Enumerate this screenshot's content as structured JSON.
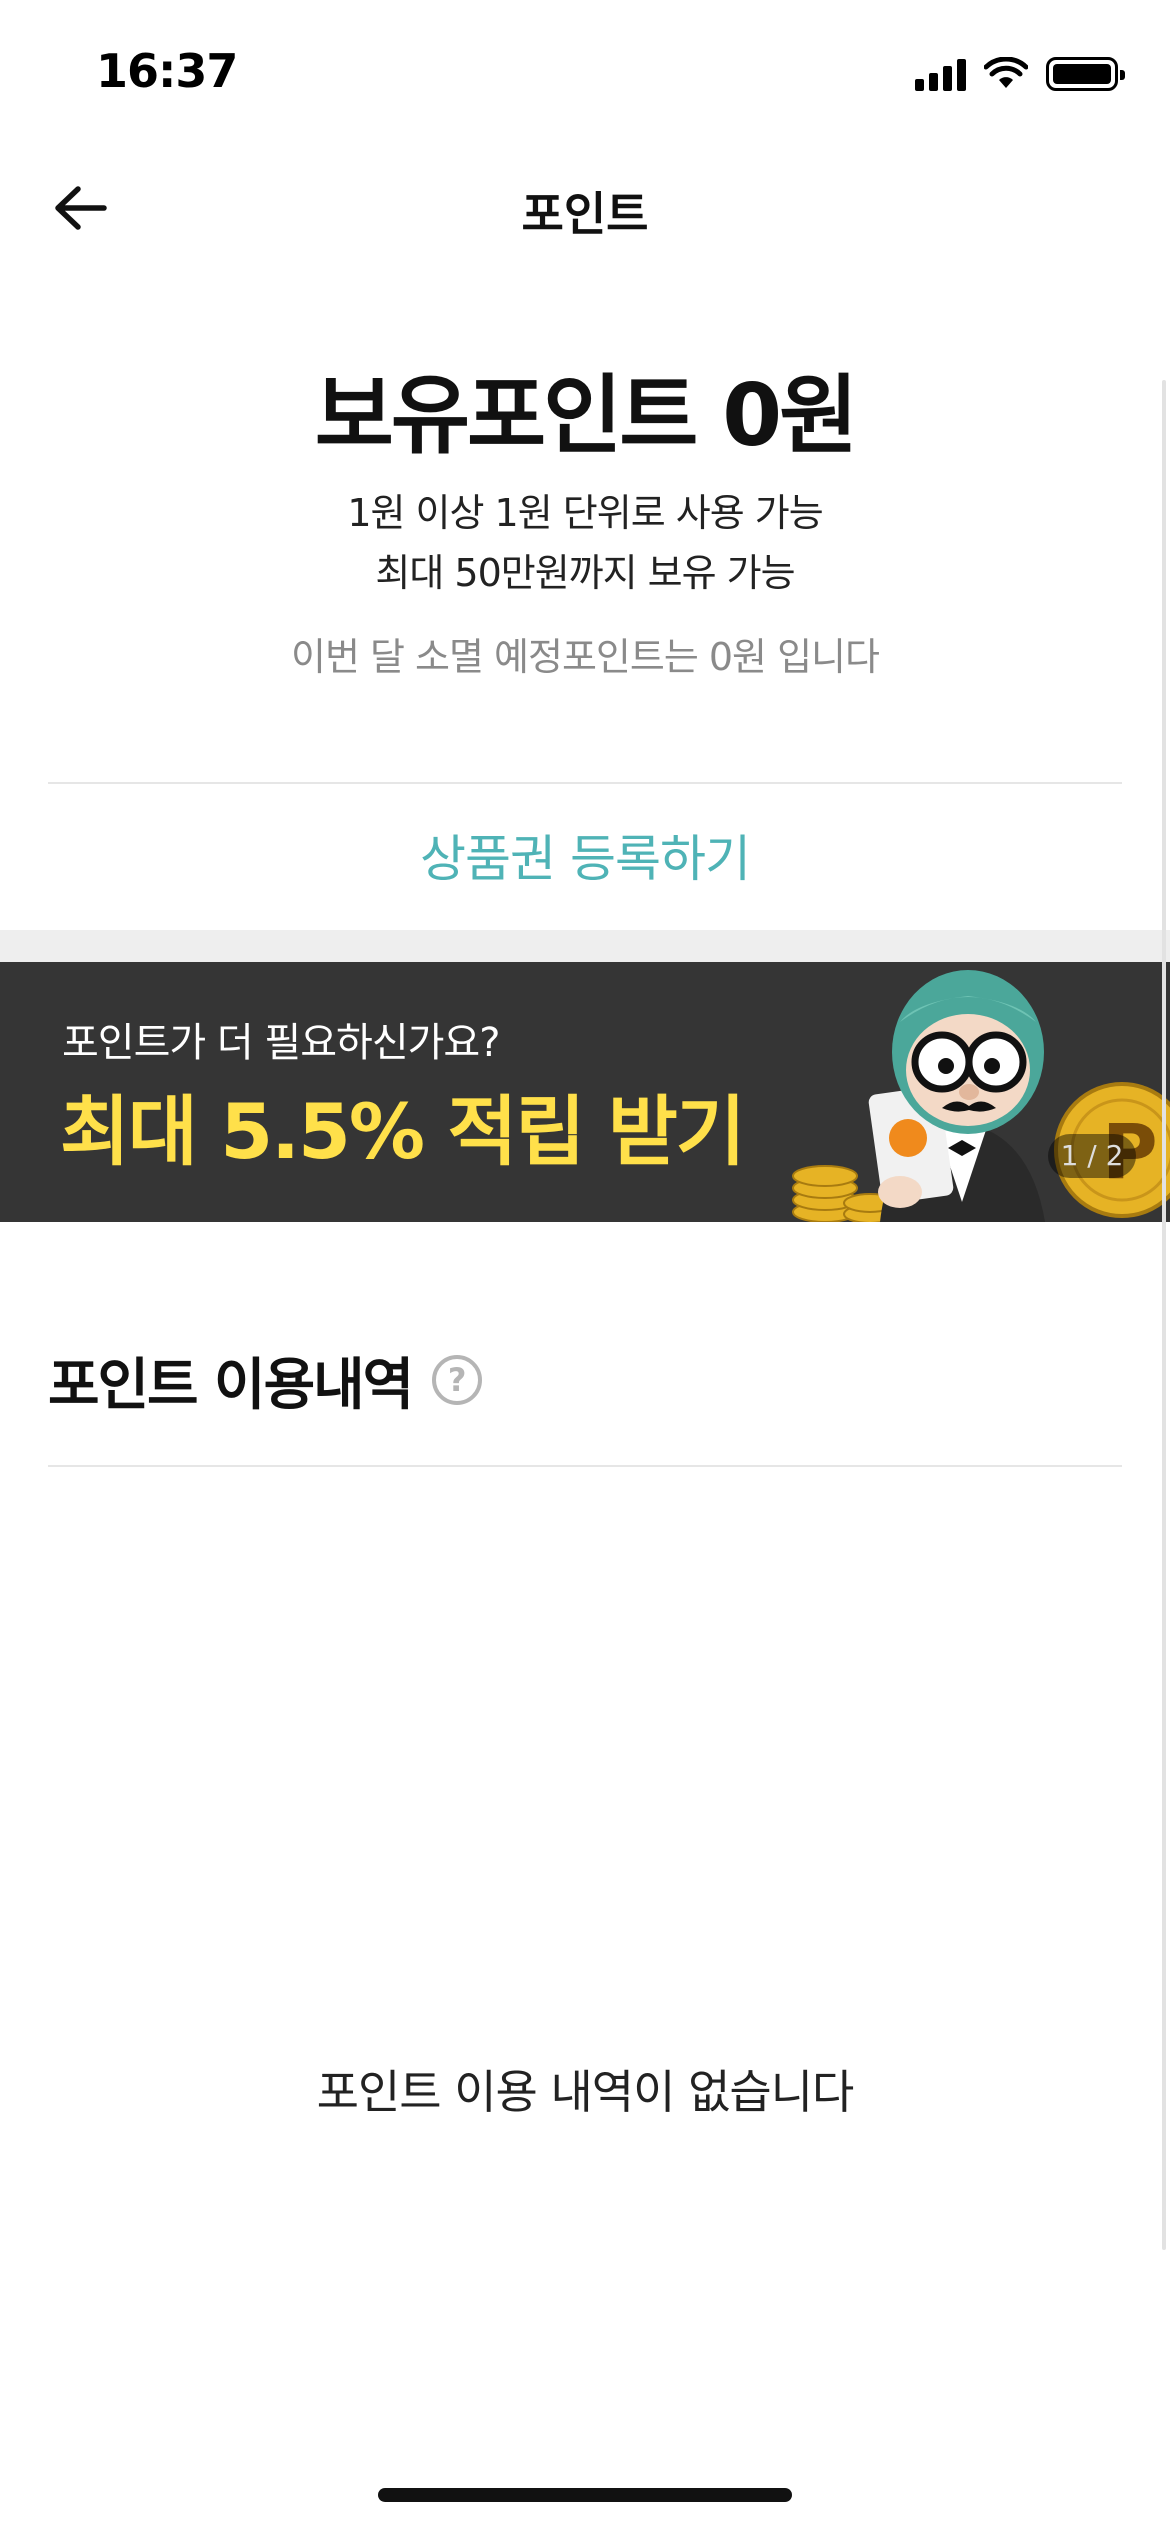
{
  "status_bar": {
    "time": "16:37"
  },
  "nav": {
    "title": "포인트"
  },
  "points": {
    "title": "보유포인트 0원",
    "rule_1": "1원 이상 1원 단위로 사용 가능",
    "rule_2": "최대 50만원까지 보유 가능",
    "expiring": "이번 달 소멸 예정포인트는 0원 입니다"
  },
  "voucher": {
    "label": "상품권 등록하기"
  },
  "banner": {
    "subtitle": "포인트가 더 필요하신가요?",
    "headline": "최대 5.5% 적립 받기",
    "indicator": "1 / 2"
  },
  "history": {
    "title": "포인트 이용내역",
    "help": "?",
    "empty_message": "포인트 이용 내역이 없습니다"
  },
  "colors": {
    "accent": "#4fb3b6",
    "banner_bg": "#353535",
    "banner_highlight": "#ffe04a"
  }
}
